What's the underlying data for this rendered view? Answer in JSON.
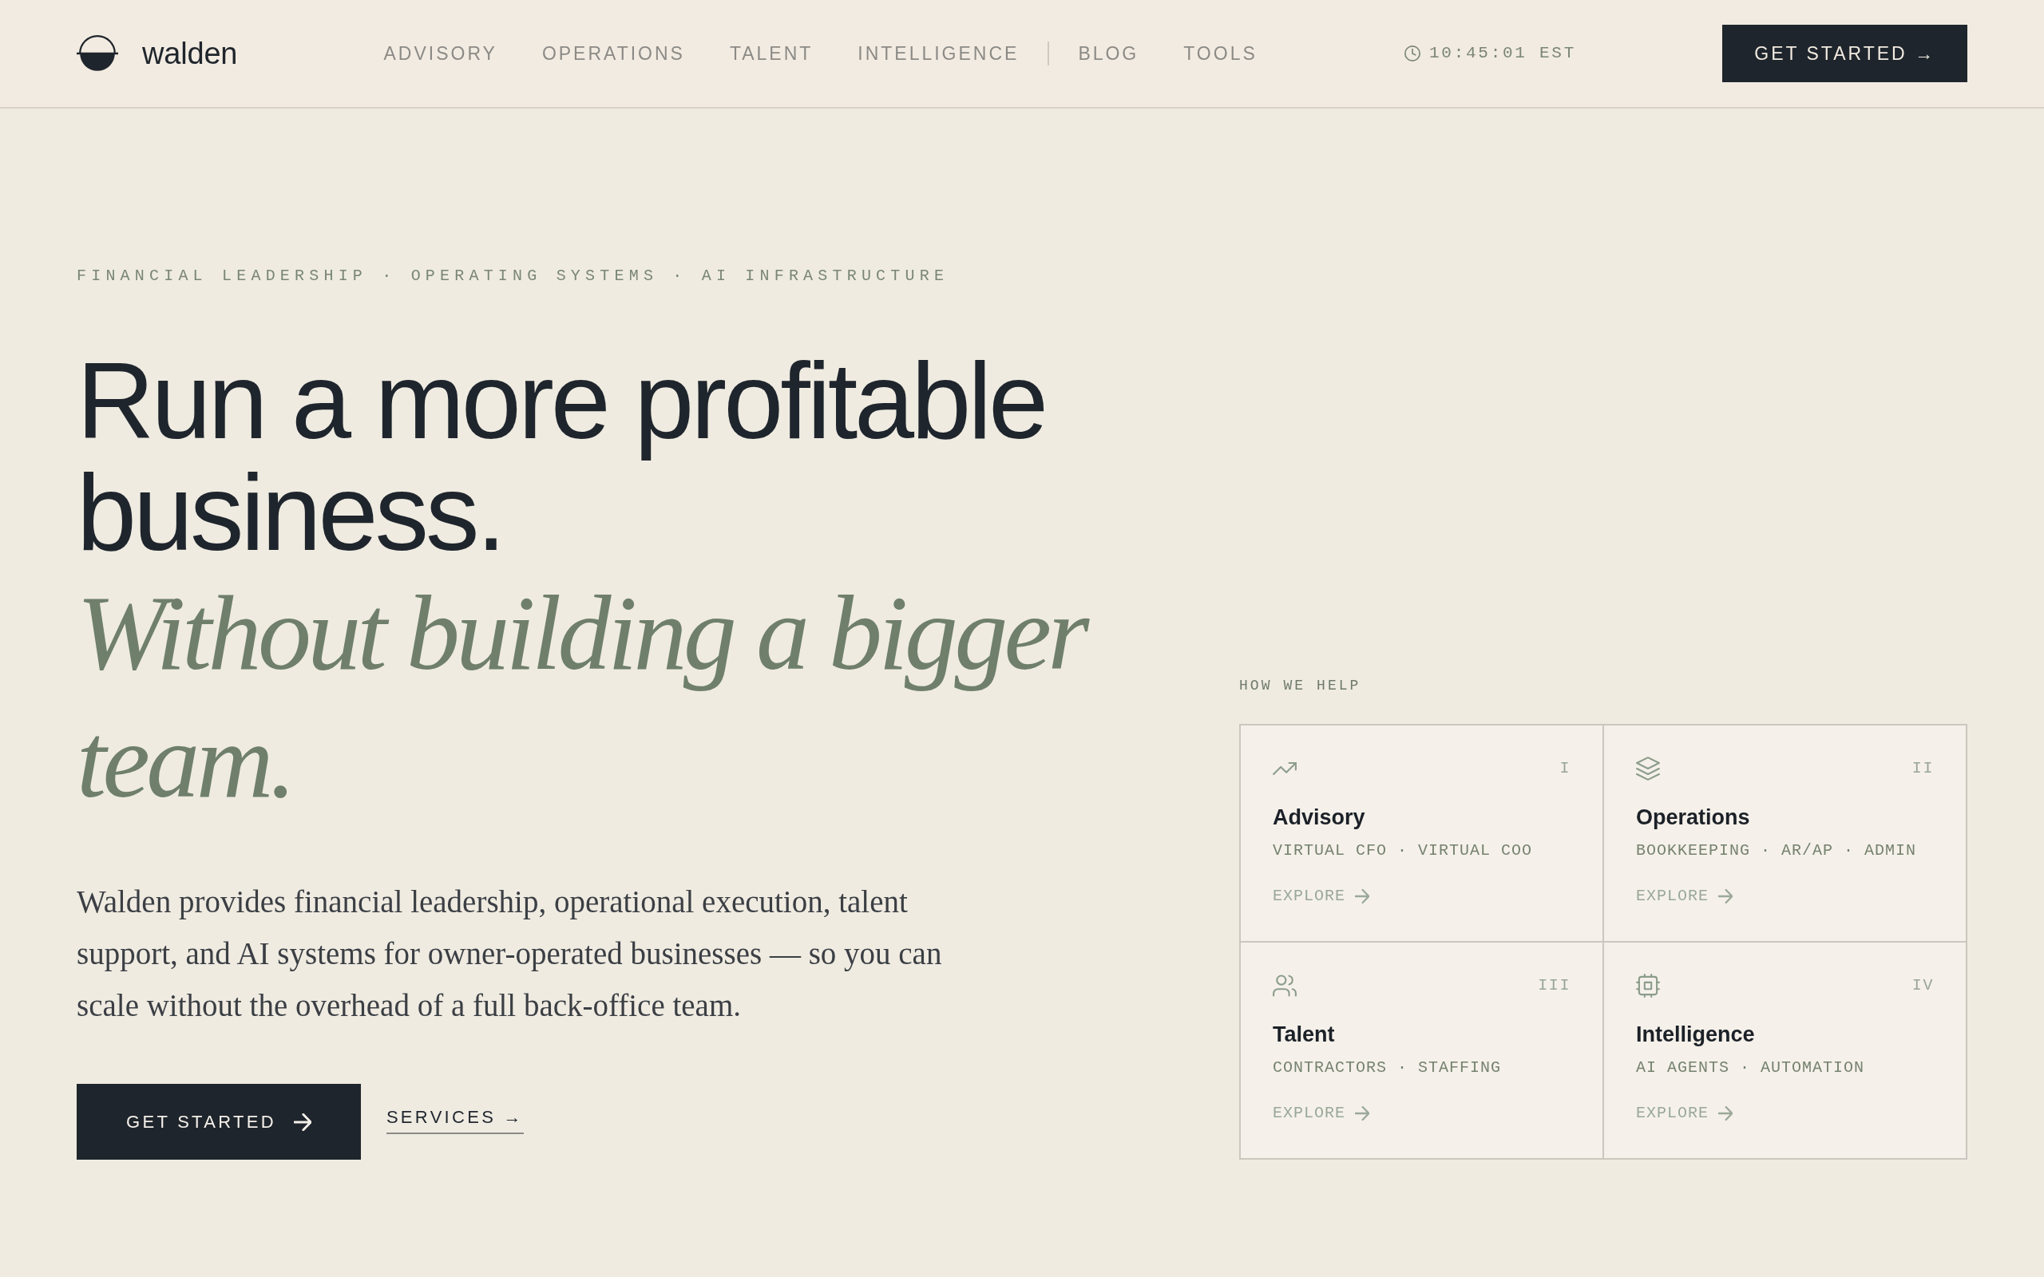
{
  "nav": {
    "brand": "walden",
    "link_groups": [
      {
        "links": [
          {
            "label": "ADVISORY"
          },
          {
            "label": "OPERATIONS"
          },
          {
            "label": "TALENT"
          },
          {
            "label": "INTELLIGENCE"
          }
        ]
      },
      {
        "links": [
          {
            "label": "BLOG"
          },
          {
            "label": "TOOLS"
          }
        ]
      }
    ],
    "clock": {
      "time": "10:45:01 EST"
    },
    "cta": "GET STARTED →"
  },
  "hero": {
    "eyebrow": "FINANCIAL LEADERSHIP · OPERATING SYSTEMS · AI INFRASTRUCTURE",
    "headline": "Run a more profitable business.",
    "headline_accent": "Without building a bigger team.",
    "body": "Walden provides financial leadership, operational execution, talent support, and AI systems for owner-operated businesses — so you can scale without the overhead of a full back-office team.",
    "primary_button": "GET STARTED",
    "secondary_link": "SERVICES →"
  },
  "services": {
    "label": "HOW WE HELP",
    "cards": [
      {
        "kind": "chart",
        "numeral": "I",
        "title": "Advisory",
        "tags": "VIRTUAL CFO · VIRTUAL COO",
        "link": "EXPLORE"
      },
      {
        "kind": "layers",
        "numeral": "II",
        "title": "Operations",
        "tags": "BOOKKEEPING · AR/AP · ADMIN",
        "link": "EXPLORE"
      },
      {
        "kind": "people",
        "numeral": "III",
        "title": "Talent",
        "tags": "CONTRACTORS · STAFFING",
        "link": "EXPLORE"
      },
      {
        "kind": "chip",
        "numeral": "IV",
        "title": "Intelligence",
        "tags": "AI AGENTS · AUTOMATION",
        "link": "EXPLORE"
      }
    ]
  }
}
